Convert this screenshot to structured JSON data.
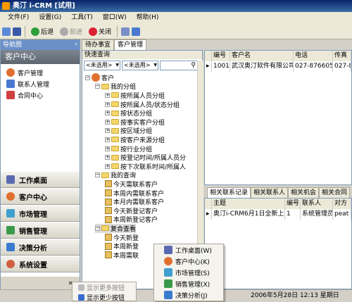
{
  "window": {
    "title": "奥汀 i-CRM [试用]"
  },
  "menu": [
    "文件(F)",
    "设置(G)",
    "工具(T)",
    "窗口(W)",
    "帮助(H)"
  ],
  "toolbar": {
    "back": "后退",
    "forward": "前进",
    "close": "关闭"
  },
  "nav": {
    "header": "导航图",
    "section": "客户中心",
    "items": [
      "客户管理",
      "联系人管理",
      "合同中心"
    ],
    "buttons": [
      "工作桌面",
      "客户中心",
      "市场管理",
      "销售管理",
      "决策分析",
      "系统设置"
    ],
    "more": "»"
  },
  "tabs": [
    "待办事宜",
    "客户管理"
  ],
  "quick": {
    "title": "快速查询",
    "filter1": "<未选用>",
    "filter2": "<未选用>"
  },
  "tree": [
    "客户",
    "我的分组",
    "按所属人员分组",
    "按所属人员/状态分组",
    "按状态分组",
    "按事实客户分组",
    "按区域分组",
    "按客户来源分组",
    "按行业分组",
    "按登记时间/所属人员分",
    "按下次联系时间/所属人",
    "我的查询",
    "今天需联系客户",
    "本周内需联系客户",
    "本月内需联系客户",
    "今天新登记客户",
    "本周新登记客户",
    "复合查看",
    "今天新登",
    "本周新登",
    "本周需联"
  ],
  "grid": {
    "headers": [
      "编号",
      "客户名",
      "电话",
      "传真"
    ],
    "rows": [
      [
        "1001",
        "武汉奥汀软件有限公司",
        "027-87660580",
        "027-87"
      ]
    ]
  },
  "related_tabs": [
    "相关联系记录",
    "相关联系人",
    "相关机会",
    "相关合同"
  ],
  "grid2": {
    "headers": [
      "主题",
      "编号",
      "联系人",
      "对方"
    ],
    "rows": [
      [
        "奥汀i-CRM6月1日全新上市",
        "1",
        "系统管理员",
        "peat"
      ]
    ]
  },
  "status": {
    "datetime": "2006年5月28日 12:13 星期日"
  },
  "popup1": [
    "显示更多按钮",
    "显示更少按钮"
  ],
  "popup2": [
    "工作桌面(W)",
    "客户中心(K)",
    "市场管理(S)",
    "销售管理(X)",
    "决策分析(J)"
  ]
}
